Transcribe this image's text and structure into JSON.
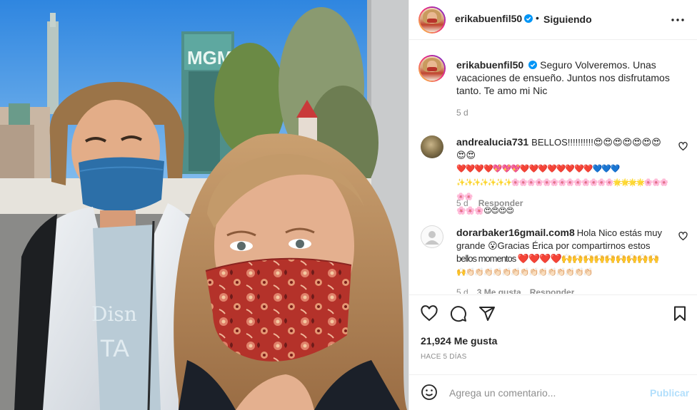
{
  "post": {
    "author": "erikabuenfil50",
    "follow_status": "Siguiendo",
    "separator": "•",
    "verified": true
  },
  "caption": {
    "username": "erikabuenfil50",
    "text": "Seguro Volveremos. Unas vacaciones de ensueño. Juntos nos disfrutamos tanto. Te amo mi Nic",
    "line1": "Seguro Volveremos. Unas",
    "line2": "vacaciones de ensueño. Juntos nos disfrutamos",
    "line3": "tanto. Te amo mi Nic",
    "age": "5 d"
  },
  "comments": [
    {
      "username": "andrealucia731",
      "line1": "BELLOS!!!!!!!!!!😍😍😍😍😍😍😍😍😍",
      "line2": "❤️❤️❤️❤️💖💖💖❤️❤️❤️❤️❤️❤️❤️❤️💙💙💙",
      "line3": "✨✨✨✨✨✨✨🌸🌸🌸🌸🌸🌸🌸🌸🌸🌸🌸🌸🌸🌟🌟🌟🌟🌸🌸🌸🌸🌸",
      "line4": "🌸🌸🌸😍😍😍😍",
      "age": "5 d",
      "reply": "Responder"
    },
    {
      "username": "dorarbaker16gmail.com8",
      "line1": "Hola Nico estás muy",
      "line2": "grande 😮Gracias Érica por compartirnos estos",
      "line3": "bellos momentos ❤️❤️❤️❤️🙌🙌🙌🙌🙌🙌🙌🙌🙌",
      "line4": "🙌👏🏻👏🏻👏🏻👏🏻👏🏻👏🏻👏🏻👏🏻👏🏻👏🏻👏🏻👏🏻👏🏻👏🏻",
      "age": "5 d",
      "likes": "3 Me gusta",
      "reply": "Responder"
    }
  ],
  "stats": {
    "likes": "21,924 Me gusta",
    "time": "HACE 5 DÍAS"
  },
  "add_comment": {
    "placeholder": "Agrega un comentario...",
    "publish": "Publicar"
  },
  "photo": {
    "sign_text": "MGM"
  },
  "icons": {
    "like": "heart-icon",
    "comment": "comment-icon",
    "share": "paper-plane-icon",
    "save": "bookmark-icon",
    "more": "more-options-icon",
    "emoji": "emoji-icon",
    "verified": "verified-badge-icon"
  },
  "colors": {
    "verified": "#0095f6",
    "publish_disabled": "#b2dffc",
    "secondary_text": "#8e8e8e",
    "divider": "#efefef"
  }
}
